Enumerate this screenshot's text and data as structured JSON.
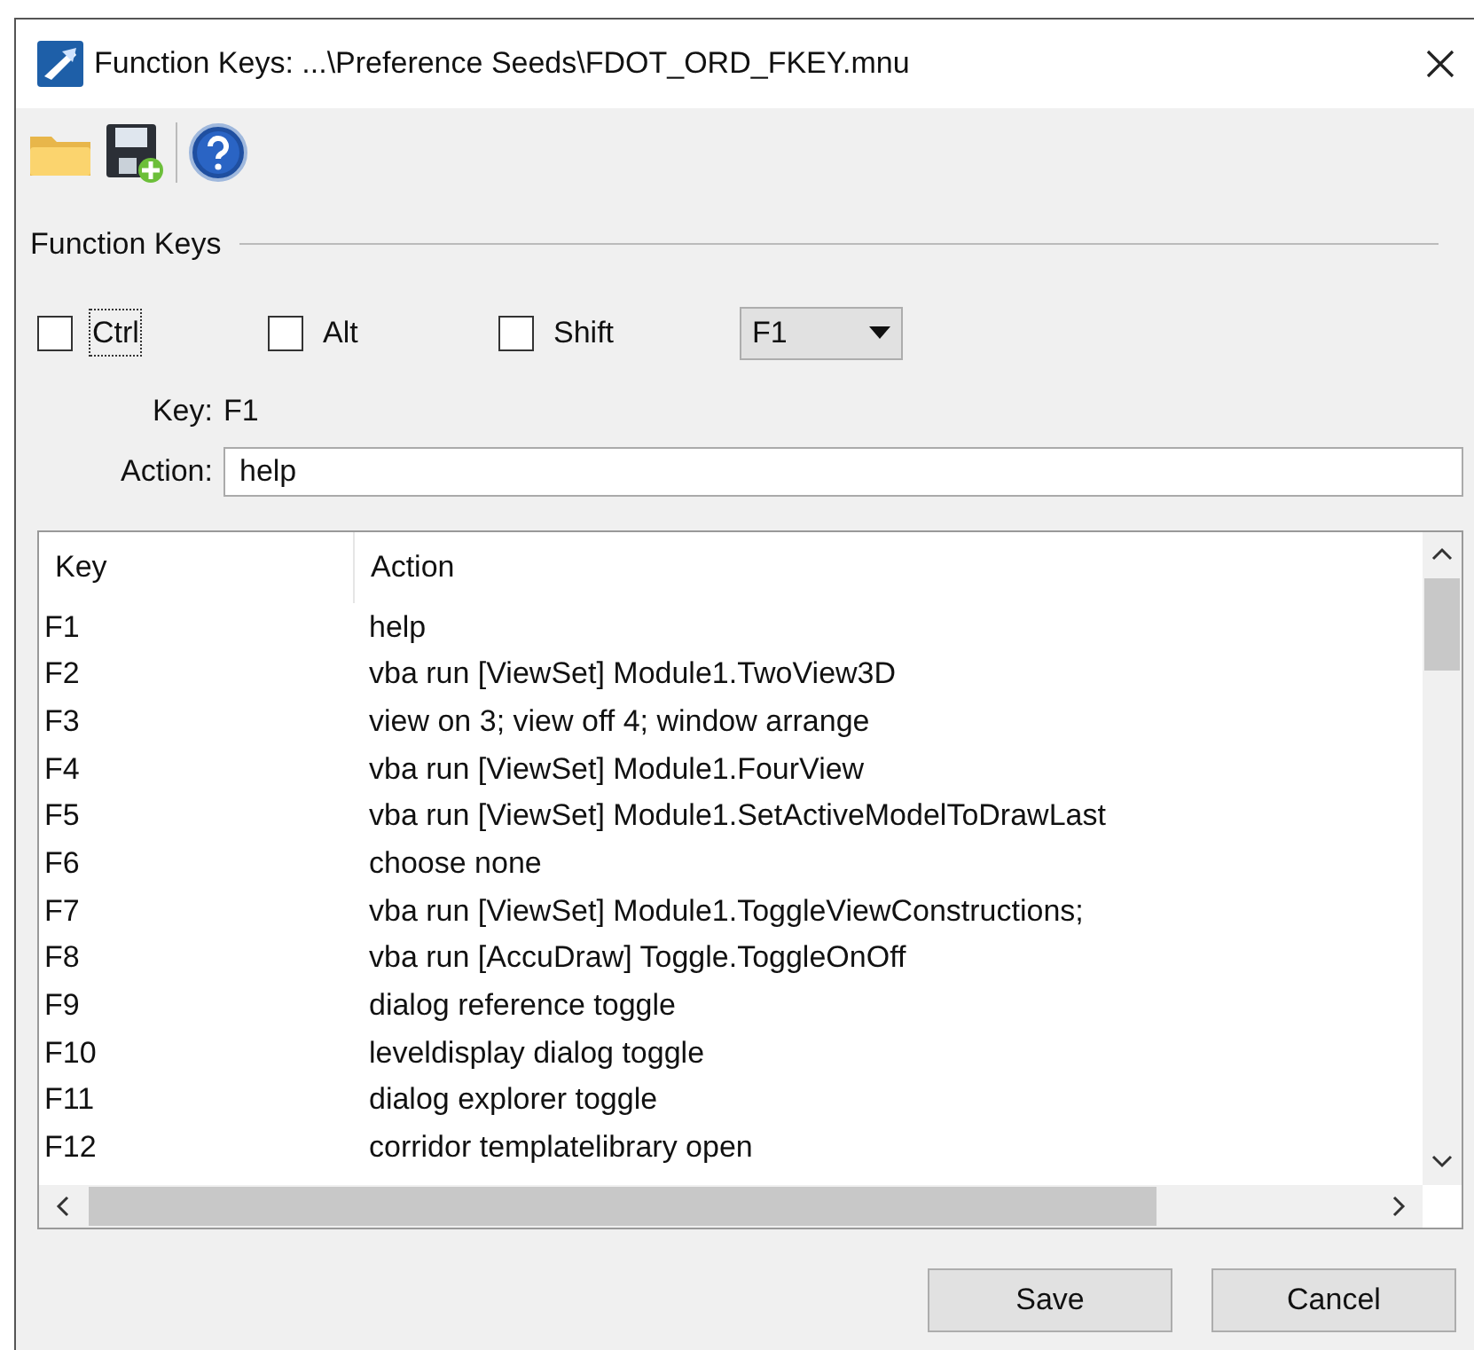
{
  "window": {
    "title": "Function Keys: ...\\Preference Seeds\\FDOT_ORD_FKEY.mnu"
  },
  "group": {
    "title": "Function Keys"
  },
  "modifiers": [
    {
      "label": "Ctrl",
      "checked": false,
      "focused": true
    },
    {
      "label": "Alt",
      "checked": false,
      "focused": false
    },
    {
      "label": "Shift",
      "checked": false,
      "focused": false
    }
  ],
  "key_dropdown": {
    "value": "F1"
  },
  "key_label": "Key:",
  "key_value": "F1",
  "action_label": "Action:",
  "action_value": "help",
  "table": {
    "columns": [
      "Key",
      "Action"
    ],
    "rows": [
      [
        "F1",
        "help"
      ],
      [
        "F2",
        "vba run [ViewSet] Module1.TwoView3D"
      ],
      [
        "F3",
        "view on 3; view off 4; window arrange"
      ],
      [
        "F4",
        "vba run [ViewSet] Module1.FourView"
      ],
      [
        "F5",
        "vba run [ViewSet] Module1.SetActiveModelToDrawLast"
      ],
      [
        "F6",
        "choose none"
      ],
      [
        "F7",
        "vba run [ViewSet] Module1.ToggleViewConstructions;"
      ],
      [
        "F8",
        "vba run [AccuDraw] Toggle.ToggleOnOff"
      ],
      [
        "F9",
        "dialog reference toggle"
      ],
      [
        "F10",
        "leveldisplay dialog toggle"
      ],
      [
        "F11",
        "dialog explorer toggle"
      ],
      [
        "F12",
        "corridor templatelibrary open"
      ]
    ]
  },
  "buttons": [
    "Save",
    "Cancel"
  ]
}
